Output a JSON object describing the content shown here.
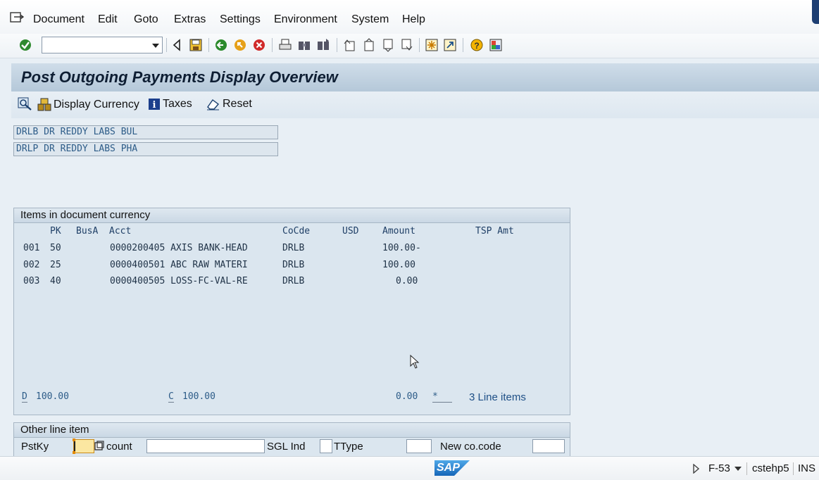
{
  "menu": {
    "items": [
      {
        "label": "Document"
      },
      {
        "label": "Edit"
      },
      {
        "label": "Goto"
      },
      {
        "label": "Extras"
      },
      {
        "label": "Settings"
      },
      {
        "label": "Environment"
      },
      {
        "label": "System"
      },
      {
        "label": "Help"
      }
    ]
  },
  "toolbar": {
    "command_value": "",
    "icons": [
      "enter-check-icon",
      "back-icon",
      "save-icon",
      "green-back-icon",
      "exit-icon",
      "cancel-icon",
      "print-icon",
      "find-icon",
      "find-next-icon",
      "first-page-icon",
      "previous-page-icon",
      "next-page-icon",
      "last-page-icon",
      "create-session-icon",
      "shortcut-icon",
      "help-icon",
      "customize-layout-icon"
    ]
  },
  "title": "Post Outgoing Payments Display Overview",
  "app_toolbar": {
    "display_currency": "Display Currency",
    "taxes": "Taxes",
    "reset": "Reset"
  },
  "header_fields": [
    "DRLB DR REDDY LABS BUL",
    "DRLP DR REDDY LABS PHA"
  ],
  "items_panel": {
    "title": "Items in document currency",
    "columns": {
      "pk": "PK",
      "busa": "BusA",
      "acct": "Acct",
      "cocde": "CoCde",
      "usd": "USD",
      "amount": "Amount",
      "tsp": "TSP Amt"
    },
    "rows": [
      {
        "no": "001",
        "pk": "50",
        "acct": "0000200405 AXIS BANK-HEAD",
        "cocde": "DRLB",
        "amount": "100.00-"
      },
      {
        "no": "002",
        "pk": "25",
        "acct": "0000400501 ABC RAW MATERI",
        "cocde": "DRLB",
        "amount": "100.00"
      },
      {
        "no": "003",
        "pk": "40",
        "acct": "0000400505 LOSS-FC-VAL-RE",
        "cocde": "DRLB",
        "amount": "0.00"
      }
    ],
    "totals": {
      "d_label": "D",
      "d_value": "100.00",
      "c_label": "C",
      "c_value": "100.00",
      "balance": "0.00",
      "star": "*",
      "line_items": "3 Line items"
    }
  },
  "other_line_item": {
    "title": "Other line item",
    "pstky_label": "PstKy",
    "account_label": "count",
    "sgl_label": "SGL Ind",
    "ttype_label": "TType",
    "newco_label": "New co.code"
  },
  "status": {
    "tcode": "F-53",
    "server": "cstehp5",
    "mode": "INS",
    "logo": "SAP"
  },
  "colors": {
    "title_bg": "#b5c8d9",
    "panel_bg": "#dbe6ef",
    "accent_blue": "#2d5c88"
  }
}
